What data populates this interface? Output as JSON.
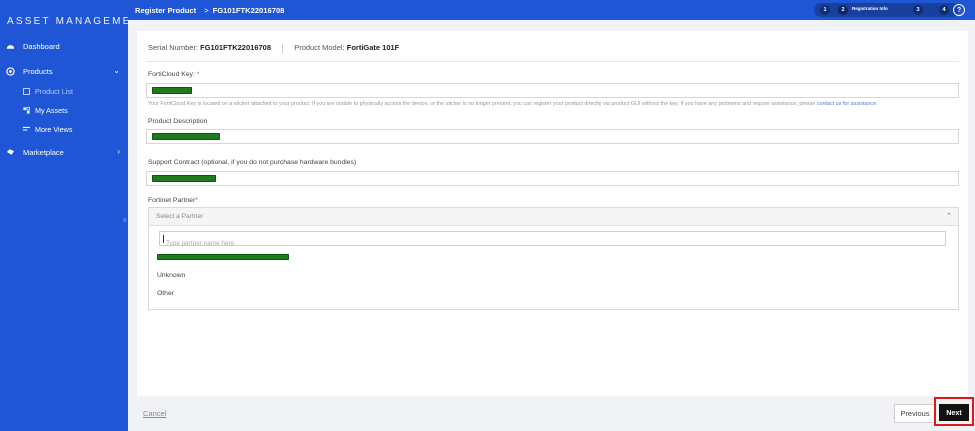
{
  "sidebar": {
    "brand": "ASSET MANAGEMENT",
    "items": [
      {
        "label": "Dashboard",
        "icon": "dashboard-icon"
      },
      {
        "label": "Products",
        "icon": "products-icon",
        "expanded": true
      },
      {
        "label": "Marketplace",
        "icon": "marketplace-icon"
      }
    ],
    "sub_items": [
      {
        "label": "Product List",
        "active": true
      },
      {
        "label": "My Assets"
      },
      {
        "label": "More Views"
      }
    ],
    "colors": {
      "background": "#1f56d6",
      "active_text": "#b8ccff"
    }
  },
  "topbar": {
    "crumb_1": "Register Product",
    "crumb_sep": ">",
    "crumb_2": "FG101FTK22016708",
    "steps": [
      "1",
      "2",
      "3",
      "4"
    ],
    "current_step_label": "Registration Info",
    "help_icon": "help-icon"
  },
  "product": {
    "serial_label": "Serial Number:",
    "serial_value": "FG101FTK22016708",
    "model_label": "Product Model:",
    "model_value": "FortiGate 101F"
  },
  "form": {
    "forticloud_key_label": "FortiCloud Key:",
    "required_marker": "*",
    "hint_text": "Your FortiCloud Key is located on a sticker attached to your product. If you are unable to physically access the device, or the sticker is no longer present, you can register your product directly via product GUI without the key. If you have any problems and require assistance, please",
    "hint_link": "contact us for assistance",
    "product_description_label": "Product Description",
    "support_contract_label": "Support Contract (optional, if you do not purchase hardware bundles)",
    "fortinet_partner_label": "Fortinet Partner",
    "partner_select_placeholder": "Select a Partner",
    "partner_search_placeholder": "Type partner name here",
    "partner_options": [
      "Unknown",
      "Other"
    ]
  },
  "footer": {
    "cancel_label": "Cancel",
    "previous_label": "Previous",
    "next_label": "Next",
    "highlight_color": "#d81b1b"
  }
}
